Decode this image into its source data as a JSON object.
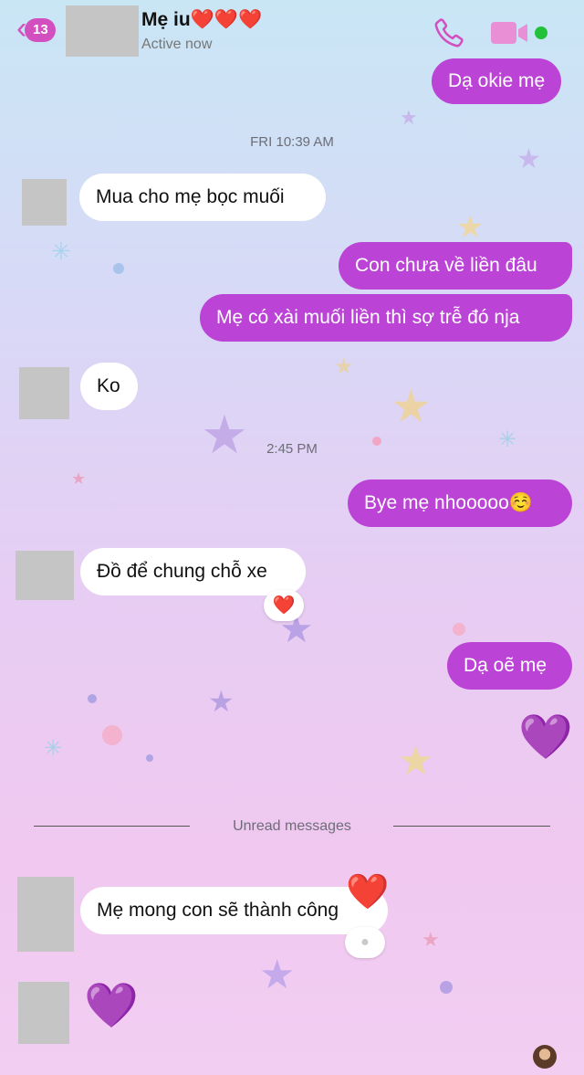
{
  "header": {
    "back_count": "13",
    "contact_name": "Mẹ iu❤️❤️❤️",
    "status": "Active now"
  },
  "messages": {
    "m0": "Dạ okie mẹ",
    "ts1": "FRI 10:39 AM",
    "m1": "Mua cho mẹ bọc muối",
    "m2": "Con chưa về liền đâu",
    "m3": "Mẹ có xài muối liền thì sợ trễ đó nja",
    "m4": "Ko",
    "ts2": "2:45 PM",
    "m5": "Bye mẹ nhooooo☺️",
    "m6": "Đồ để chung chỗ xe",
    "m6_reaction": "❤️",
    "m7": "Dạ oẽ mẹ",
    "m8": "💜",
    "unread_label": "Unread messages",
    "m9": "Mẹ mong con sẽ thành công",
    "m9_heart": "❤️",
    "m10": "💜"
  },
  "colors": {
    "outgoing_bubble": "#bb43d5",
    "incoming_bubble": "#ffffff",
    "accent": "#d24fc0",
    "online": "#22c13a"
  },
  "icons": [
    "back-chevron-icon",
    "phone-icon",
    "video-camera-icon",
    "online-status-icon"
  ]
}
